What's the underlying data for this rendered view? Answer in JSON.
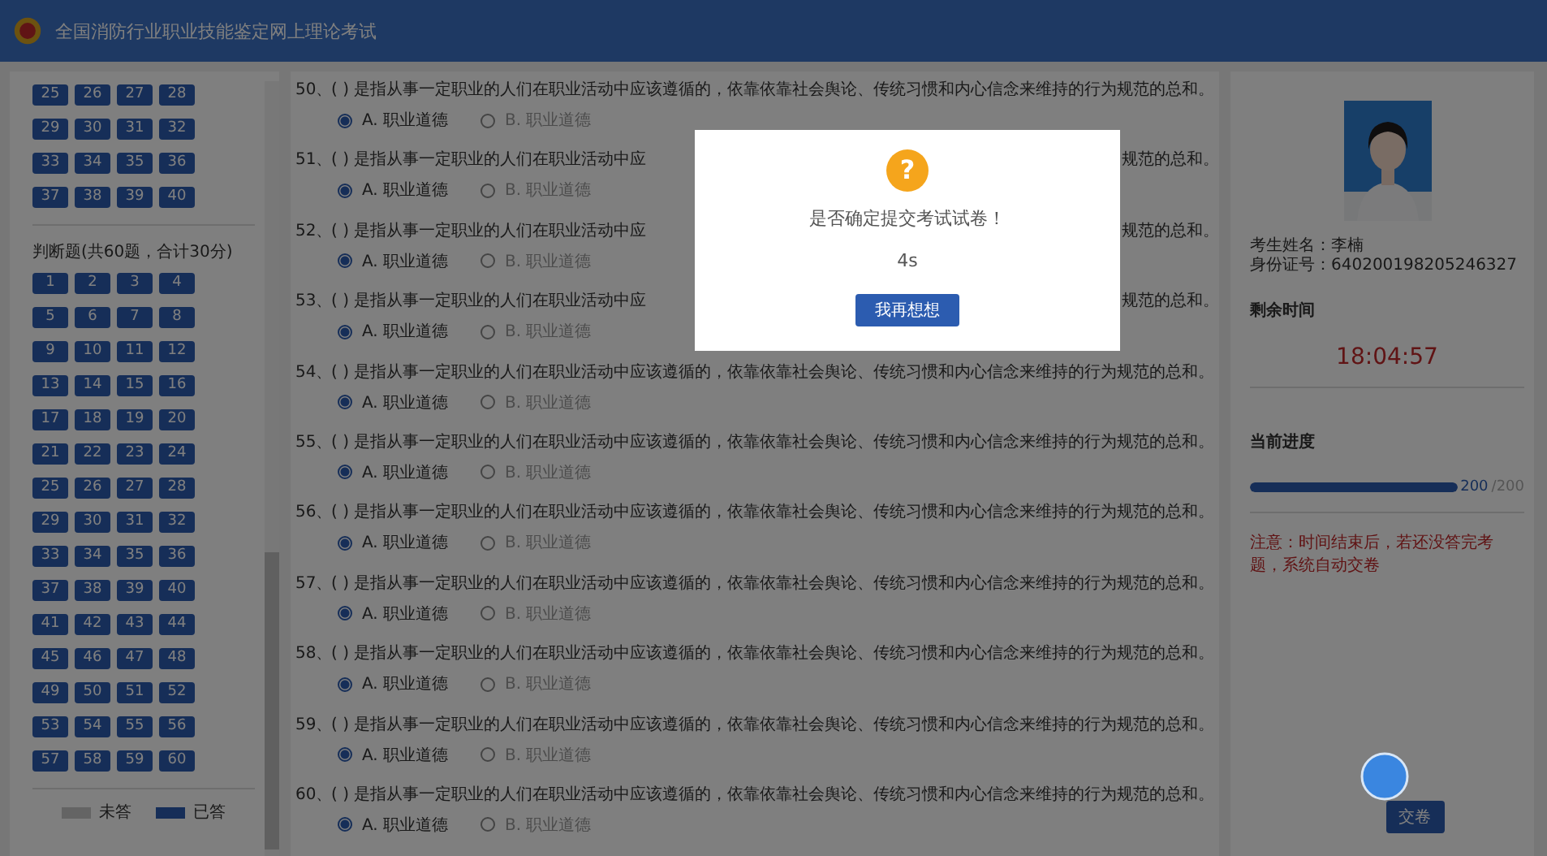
{
  "header": {
    "title": "全国消防行业职业技能鉴定网上理论考试"
  },
  "answer_sheet": {
    "sections": [
      {
        "items": [
          {
            "label": "25",
            "answered": true
          },
          {
            "label": "26",
            "answered": true
          },
          {
            "label": "27",
            "answered": true
          },
          {
            "label": "28",
            "answered": true
          },
          {
            "label": "29",
            "answered": true
          },
          {
            "label": "30",
            "answered": true
          },
          {
            "label": "31",
            "answered": true
          },
          {
            "label": "32",
            "answered": true
          },
          {
            "label": "33",
            "answered": true
          },
          {
            "label": "34",
            "answered": true
          },
          {
            "label": "35",
            "answered": true
          },
          {
            "label": "36",
            "answered": true
          },
          {
            "label": "37",
            "answered": true
          },
          {
            "label": "38",
            "answered": true
          },
          {
            "label": "39",
            "answered": true
          },
          {
            "label": "40",
            "answered": true
          }
        ]
      },
      {
        "title": "判断题(共60题，合计30分)",
        "items": [
          {
            "label": "1",
            "answered": true
          },
          {
            "label": "2",
            "answered": true
          },
          {
            "label": "3",
            "answered": true
          },
          {
            "label": "4",
            "answered": true
          },
          {
            "label": "5",
            "answered": true
          },
          {
            "label": "6",
            "answered": true
          },
          {
            "label": "7",
            "answered": true
          },
          {
            "label": "8",
            "answered": true
          },
          {
            "label": "9",
            "answered": true
          },
          {
            "label": "10",
            "answered": true
          },
          {
            "label": "11",
            "answered": true
          },
          {
            "label": "12",
            "answered": true
          },
          {
            "label": "13",
            "answered": true
          },
          {
            "label": "14",
            "answered": true
          },
          {
            "label": "15",
            "answered": true
          },
          {
            "label": "16",
            "answered": true
          },
          {
            "label": "17",
            "answered": true
          },
          {
            "label": "18",
            "answered": true
          },
          {
            "label": "19",
            "answered": true
          },
          {
            "label": "20",
            "answered": true
          },
          {
            "label": "21",
            "answered": true
          },
          {
            "label": "22",
            "answered": true
          },
          {
            "label": "23",
            "answered": true
          },
          {
            "label": "24",
            "answered": true
          },
          {
            "label": "25",
            "answered": true
          },
          {
            "label": "26",
            "answered": true
          },
          {
            "label": "27",
            "answered": true
          },
          {
            "label": "28",
            "answered": true
          },
          {
            "label": "29",
            "answered": true
          },
          {
            "label": "30",
            "answered": true
          },
          {
            "label": "31",
            "answered": true
          },
          {
            "label": "32",
            "answered": true
          },
          {
            "label": "33",
            "answered": true
          },
          {
            "label": "34",
            "answered": true
          },
          {
            "label": "35",
            "answered": true
          },
          {
            "label": "36",
            "answered": true
          },
          {
            "label": "37",
            "answered": true
          },
          {
            "label": "38",
            "answered": true
          },
          {
            "label": "39",
            "answered": true
          },
          {
            "label": "40",
            "answered": true
          },
          {
            "label": "41",
            "answered": true
          },
          {
            "label": "42",
            "answered": true
          },
          {
            "label": "43",
            "answered": true
          },
          {
            "label": "44",
            "answered": true
          },
          {
            "label": "45",
            "answered": true
          },
          {
            "label": "46",
            "answered": true
          },
          {
            "label": "47",
            "answered": true
          },
          {
            "label": "48",
            "answered": true
          },
          {
            "label": "49",
            "answered": true
          },
          {
            "label": "50",
            "answered": true
          },
          {
            "label": "51",
            "answered": true
          },
          {
            "label": "52",
            "answered": true
          },
          {
            "label": "53",
            "answered": true
          },
          {
            "label": "54",
            "answered": true
          },
          {
            "label": "55",
            "answered": true
          },
          {
            "label": "56",
            "answered": true
          },
          {
            "label": "57",
            "answered": true
          },
          {
            "label": "58",
            "answered": true
          },
          {
            "label": "59",
            "answered": true
          },
          {
            "label": "60",
            "answered": true
          }
        ]
      }
    ],
    "legend": [
      {
        "label": "未答",
        "kind": "unanswered"
      },
      {
        "label": "已答",
        "kind": "answered"
      }
    ]
  },
  "questions": [
    {
      "number": "50、",
      "text": "( ) 是指从事一定职业的人们在职业活动中应该遵循的，依靠依靠社会舆论、传统习惯和内心信念来维持的行为规范的总和。",
      "options": [
        {
          "label": "A. 职业道德",
          "selected": true
        },
        {
          "label": "B. 职业道德",
          "selected": false
        }
      ]
    },
    {
      "number": "51、",
      "text": "( ) 是指从事一定职业的人们在职业活动中应",
      "text_end": "规范的总和。",
      "options": [
        {
          "label": "A. 职业道德",
          "selected": true
        },
        {
          "label": "B. 职业道德",
          "selected": false
        }
      ]
    },
    {
      "number": "52、",
      "text": "( ) 是指从事一定职业的人们在职业活动中应",
      "text_end": "规范的总和。",
      "options": [
        {
          "label": "A. 职业道德",
          "selected": true
        },
        {
          "label": "B. 职业道德",
          "selected": false
        }
      ]
    },
    {
      "number": "53、",
      "text": "( ) 是指从事一定职业的人们在职业活动中应",
      "text_end": "规范的总和。",
      "options": [
        {
          "label": "A. 职业道德",
          "selected": true
        },
        {
          "label": "B. 职业道德",
          "selected": false
        }
      ]
    },
    {
      "number": "54、",
      "text": "( ) 是指从事一定职业的人们在职业活动中应该遵循的，依靠依靠社会舆论、传统习惯和内心信念来维持的行为规范的总和。",
      "options": [
        {
          "label": "A. 职业道德",
          "selected": true
        },
        {
          "label": "B. 职业道德",
          "selected": false
        }
      ]
    },
    {
      "number": "55、",
      "text": "( ) 是指从事一定职业的人们在职业活动中应该遵循的，依靠依靠社会舆论、传统习惯和内心信念来维持的行为规范的总和。",
      "options": [
        {
          "label": "A. 职业道德",
          "selected": true
        },
        {
          "label": "B. 职业道德",
          "selected": false
        }
      ]
    },
    {
      "number": "56、",
      "text": "( ) 是指从事一定职业的人们在职业活动中应该遵循的，依靠依靠社会舆论、传统习惯和内心信念来维持的行为规范的总和。",
      "options": [
        {
          "label": "A. 职业道德",
          "selected": true
        },
        {
          "label": "B. 职业道德",
          "selected": false
        }
      ]
    },
    {
      "number": "57、",
      "text": "( ) 是指从事一定职业的人们在职业活动中应该遵循的，依靠依靠社会舆论、传统习惯和内心信念来维持的行为规范的总和。",
      "options": [
        {
          "label": "A. 职业道德",
          "selected": true
        },
        {
          "label": "B. 职业道德",
          "selected": false
        }
      ]
    },
    {
      "number": "58、",
      "text": "( ) 是指从事一定职业的人们在职业活动中应该遵循的，依靠依靠社会舆论、传统习惯和内心信念来维持的行为规范的总和。",
      "options": [
        {
          "label": "A. 职业道德",
          "selected": true
        },
        {
          "label": "B. 职业道德",
          "selected": false
        }
      ]
    },
    {
      "number": "59、",
      "text": "( ) 是指从事一定职业的人们在职业活动中应该遵循的，依靠依靠社会舆论、传统习惯和内心信念来维持的行为规范的总和。",
      "options": [
        {
          "label": "A. 职业道德",
          "selected": true
        },
        {
          "label": "B. 职业道德",
          "selected": false
        }
      ]
    },
    {
      "number": "60、",
      "text": "( ) 是指从事一定职业的人们在职业活动中应该遵循的，依靠依靠社会舆论、传统习惯和内心信念来维持的行为规范的总和。",
      "options": [
        {
          "label": "A. 职业道德",
          "selected": true
        },
        {
          "label": "B. 职业道德",
          "selected": false
        }
      ]
    }
  ],
  "candidate": {
    "name_line": "考生姓名：李楠",
    "id_line": "身份证号：640200198205246327"
  },
  "timer": {
    "title": "剩余时间",
    "value": "18:04:57"
  },
  "progress": {
    "title": "当前进度",
    "level": 1,
    "done": "200",
    "total": "/200"
  },
  "notice": "注意：时间结束后，若还没答完考题，系统自动交卷",
  "submit_button": {
    "label": "交卷"
  },
  "dialog": {
    "icon": "?",
    "message": "是否确定提交考试试卷！",
    "countdown": "4s",
    "button": "我再想想"
  }
}
